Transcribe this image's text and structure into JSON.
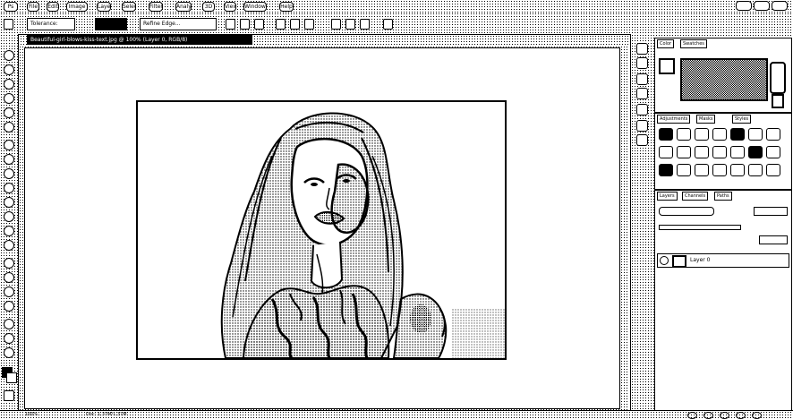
{
  "menubar": {
    "items": [
      "Ps",
      "File",
      "Edit",
      "Image",
      "Layer",
      "Select",
      "Filter",
      "Analysis",
      "3D",
      "View",
      "Window",
      "Help"
    ]
  },
  "options": {
    "preset": "Tolerance:",
    "mode": "Contiguous",
    "refine": "Refine Edge..."
  },
  "document": {
    "tab_title": "Beautiful-girl-blows-kiss-text.jpg @ 100% (Layer 0, RGB/8)"
  },
  "panels": {
    "color_tabs": [
      "Color",
      "Swatches"
    ],
    "style_tabs": [
      "Adjustments",
      "Masks",
      "Styles"
    ],
    "layers_tabs": [
      "Layers",
      "Channels",
      "Paths"
    ],
    "layer_name": "Layer 0"
  },
  "statusbar": {
    "zoom": "100%",
    "doc": "Doc: 1.37M/1.37M"
  }
}
